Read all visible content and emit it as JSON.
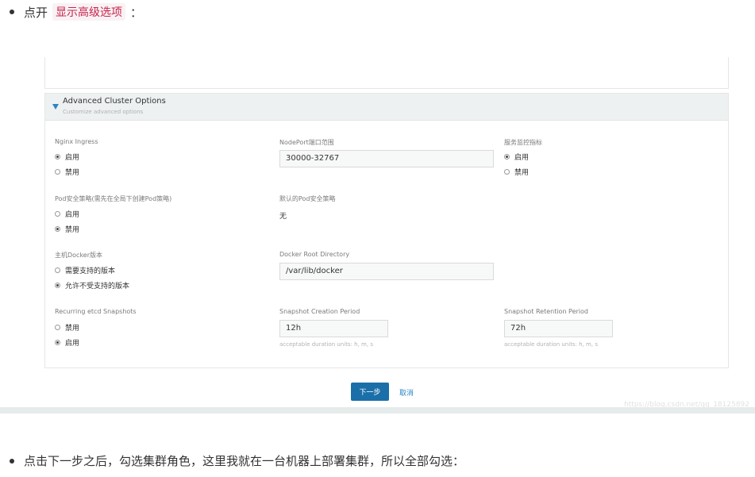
{
  "intro": {
    "text": "点开",
    "highlight": "显示高级选项",
    "suffix": "："
  },
  "panel": {
    "title": "Advanced Cluster Options",
    "subtitle": "Customize advanced options"
  },
  "fields": {
    "nginx": {
      "label": "Nginx Ingress",
      "options": [
        "启用",
        "禁用"
      ],
      "selected": 0
    },
    "nodeport": {
      "label": "NodePort端口范围",
      "value": "30000-32767"
    },
    "monitoring": {
      "label": "服务监控指标",
      "options": [
        "启用",
        "禁用"
      ],
      "selected": 0
    },
    "pod_security": {
      "label": "Pod安全策略(需先在全局下创建Pod策略)",
      "options": [
        "启用",
        "禁用"
      ],
      "selected": 1
    },
    "default_pod_policy": {
      "label": "默认的Pod安全策略",
      "value": "无"
    },
    "docker_version": {
      "label": "主机Docker版本",
      "options": [
        "需要支持的版本",
        "允许不受支持的版本"
      ],
      "selected": 1
    },
    "docker_root": {
      "label": "Docker Root Directory",
      "value": "/var/lib/docker"
    },
    "etcd_snapshots": {
      "label": "Recurring etcd Snapshots",
      "options": [
        "禁用",
        "启用"
      ],
      "selected": 1
    },
    "snapshot_creation": {
      "label": "Snapshot Creation Period",
      "value": "12h",
      "hint": "acceptable duration units: h, m, s"
    },
    "snapshot_retention": {
      "label": "Snapshot Retention Period",
      "value": "72h",
      "hint": "acceptable duration units: h, m, s"
    }
  },
  "actions": {
    "next": "下一步",
    "cancel": "取消"
  },
  "watermark": "https://blog.csdn.net/qq_18125892",
  "outro": {
    "text": "点击下一步之后，勾选集群角色，这里我就在一台机器上部署集群，所以全部勾选："
  }
}
